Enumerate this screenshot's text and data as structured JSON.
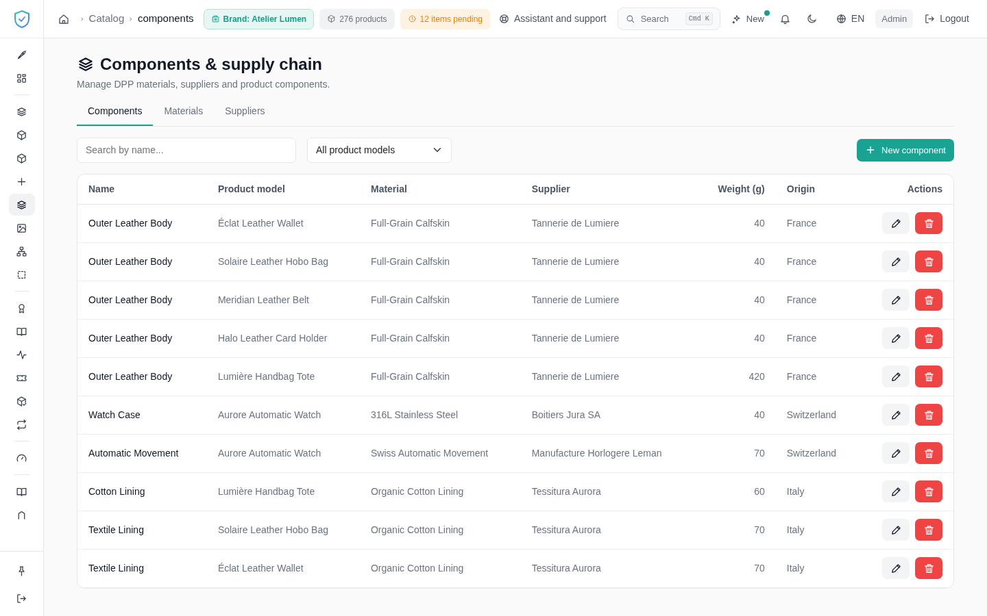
{
  "sidebar": {
    "groups": [
      {
        "items": [
          {
            "selected": false
          },
          {
            "selected": false
          }
        ]
      },
      {
        "items": [
          {
            "selected": false
          },
          {
            "selected": false
          },
          {
            "selected": false
          },
          {
            "selected": false
          },
          {
            "selected": true
          },
          {
            "selected": false
          },
          {
            "selected": false
          },
          {
            "selected": false
          }
        ]
      },
      {
        "items": [
          {
            "selected": false
          },
          {
            "selected": false
          },
          {
            "selected": false
          },
          {
            "selected": false
          },
          {
            "selected": false
          },
          {
            "selected": false
          }
        ]
      },
      {
        "items": [
          {
            "selected": false
          }
        ]
      },
      {
        "items": [
          {
            "selected": false
          },
          {
            "selected": false
          }
        ]
      }
    ],
    "footer": [
      {
        "selected": false
      },
      {
        "selected": false
      }
    ]
  },
  "breadcrumb": [
    "Catalog",
    "components"
  ],
  "badges": [
    {
      "kind": "brand",
      "label": "Brand: Atelier Lumen"
    },
    {
      "kind": "neutral",
      "label": "276 products"
    },
    {
      "kind": "warning",
      "label": "12 items pending"
    }
  ],
  "topbar": {
    "support": "Assistant and support",
    "search": {
      "label": "Search",
      "shortcut": "Cmd K"
    },
    "new": {
      "label": "New",
      "unread": true
    },
    "language": "EN",
    "role": "Admin",
    "logout": "Logout"
  },
  "page": {
    "title": "Components & supply chain",
    "subtitle": "Manage DPP materials, suppliers and product components."
  },
  "tabs": [
    {
      "label": "Components",
      "selected": true
    },
    {
      "label": "Materials",
      "selected": false
    },
    {
      "label": "Suppliers",
      "selected": false
    }
  ],
  "filters": {
    "search_placeholder": "Search by name...",
    "model_select": "All product models",
    "new_button": "New component"
  },
  "table": {
    "columns": [
      "Name",
      "Product model",
      "Material",
      "Supplier",
      "Weight (g)",
      "Origin",
      "Actions"
    ],
    "rows": [
      [
        "Outer Leather Body",
        "Éclat Leather Wallet",
        "Full-Grain Calfskin",
        "Tannerie de Lumiere",
        "40",
        "France"
      ],
      [
        "Outer Leather Body",
        "Solaire Leather Hobo Bag",
        "Full-Grain Calfskin",
        "Tannerie de Lumiere",
        "40",
        "France"
      ],
      [
        "Outer Leather Body",
        "Meridian Leather Belt",
        "Full-Grain Calfskin",
        "Tannerie de Lumiere",
        "40",
        "France"
      ],
      [
        "Outer Leather Body",
        "Halo Leather Card Holder",
        "Full-Grain Calfskin",
        "Tannerie de Lumiere",
        "40",
        "France"
      ],
      [
        "Outer Leather Body",
        "Lumière Handbag Tote",
        "Full-Grain Calfskin",
        "Tannerie de Lumiere",
        "420",
        "France"
      ],
      [
        "Watch Case",
        "Aurore Automatic Watch",
        "316L Stainless Steel",
        "Boitiers Jura SA",
        "40",
        "Switzerland"
      ],
      [
        "Automatic Movement",
        "Aurore Automatic Watch",
        "Swiss Automatic Movement",
        "Manufacture Horlogere Leman",
        "70",
        "Switzerland"
      ],
      [
        "Cotton Lining",
        "Lumière Handbag Tote",
        "Organic Cotton Lining",
        "Tessitura Aurora",
        "60",
        "Italy"
      ],
      [
        "Textile Lining",
        "Solaire Leather Hobo Bag",
        "Organic Cotton Lining",
        "Tessitura Aurora",
        "70",
        "Italy"
      ],
      [
        "Textile Lining",
        "Éclat Leather Wallet",
        "Organic Cotton Lining",
        "Tessitura Aurora",
        "70",
        "Italy"
      ]
    ]
  }
}
